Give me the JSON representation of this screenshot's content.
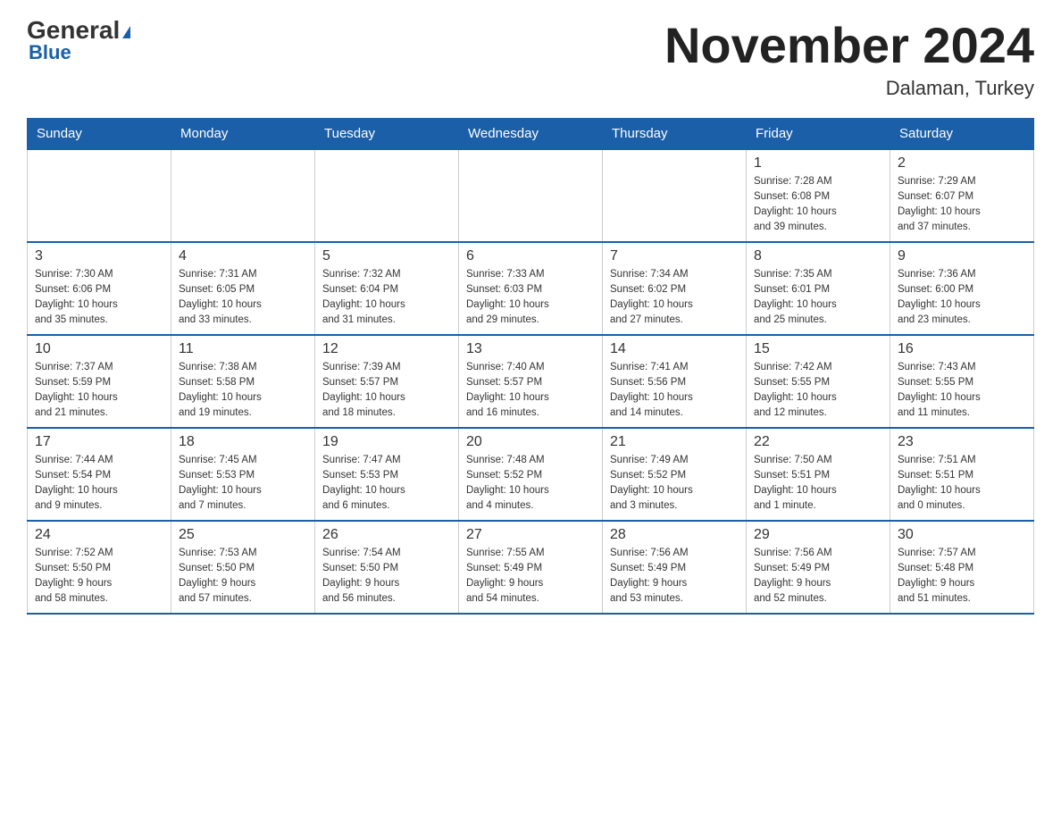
{
  "header": {
    "logo_general": "General",
    "logo_blue": "Blue",
    "month_title": "November 2024",
    "location": "Dalaman, Turkey"
  },
  "calendar": {
    "days_of_week": [
      "Sunday",
      "Monday",
      "Tuesday",
      "Wednesday",
      "Thursday",
      "Friday",
      "Saturday"
    ],
    "weeks": [
      [
        {
          "day": "",
          "info": ""
        },
        {
          "day": "",
          "info": ""
        },
        {
          "day": "",
          "info": ""
        },
        {
          "day": "",
          "info": ""
        },
        {
          "day": "",
          "info": ""
        },
        {
          "day": "1",
          "info": "Sunrise: 7:28 AM\nSunset: 6:08 PM\nDaylight: 10 hours\nand 39 minutes."
        },
        {
          "day": "2",
          "info": "Sunrise: 7:29 AM\nSunset: 6:07 PM\nDaylight: 10 hours\nand 37 minutes."
        }
      ],
      [
        {
          "day": "3",
          "info": "Sunrise: 7:30 AM\nSunset: 6:06 PM\nDaylight: 10 hours\nand 35 minutes."
        },
        {
          "day": "4",
          "info": "Sunrise: 7:31 AM\nSunset: 6:05 PM\nDaylight: 10 hours\nand 33 minutes."
        },
        {
          "day": "5",
          "info": "Sunrise: 7:32 AM\nSunset: 6:04 PM\nDaylight: 10 hours\nand 31 minutes."
        },
        {
          "day": "6",
          "info": "Sunrise: 7:33 AM\nSunset: 6:03 PM\nDaylight: 10 hours\nand 29 minutes."
        },
        {
          "day": "7",
          "info": "Sunrise: 7:34 AM\nSunset: 6:02 PM\nDaylight: 10 hours\nand 27 minutes."
        },
        {
          "day": "8",
          "info": "Sunrise: 7:35 AM\nSunset: 6:01 PM\nDaylight: 10 hours\nand 25 minutes."
        },
        {
          "day": "9",
          "info": "Sunrise: 7:36 AM\nSunset: 6:00 PM\nDaylight: 10 hours\nand 23 minutes."
        }
      ],
      [
        {
          "day": "10",
          "info": "Sunrise: 7:37 AM\nSunset: 5:59 PM\nDaylight: 10 hours\nand 21 minutes."
        },
        {
          "day": "11",
          "info": "Sunrise: 7:38 AM\nSunset: 5:58 PM\nDaylight: 10 hours\nand 19 minutes."
        },
        {
          "day": "12",
          "info": "Sunrise: 7:39 AM\nSunset: 5:57 PM\nDaylight: 10 hours\nand 18 minutes."
        },
        {
          "day": "13",
          "info": "Sunrise: 7:40 AM\nSunset: 5:57 PM\nDaylight: 10 hours\nand 16 minutes."
        },
        {
          "day": "14",
          "info": "Sunrise: 7:41 AM\nSunset: 5:56 PM\nDaylight: 10 hours\nand 14 minutes."
        },
        {
          "day": "15",
          "info": "Sunrise: 7:42 AM\nSunset: 5:55 PM\nDaylight: 10 hours\nand 12 minutes."
        },
        {
          "day": "16",
          "info": "Sunrise: 7:43 AM\nSunset: 5:55 PM\nDaylight: 10 hours\nand 11 minutes."
        }
      ],
      [
        {
          "day": "17",
          "info": "Sunrise: 7:44 AM\nSunset: 5:54 PM\nDaylight: 10 hours\nand 9 minutes."
        },
        {
          "day": "18",
          "info": "Sunrise: 7:45 AM\nSunset: 5:53 PM\nDaylight: 10 hours\nand 7 minutes."
        },
        {
          "day": "19",
          "info": "Sunrise: 7:47 AM\nSunset: 5:53 PM\nDaylight: 10 hours\nand 6 minutes."
        },
        {
          "day": "20",
          "info": "Sunrise: 7:48 AM\nSunset: 5:52 PM\nDaylight: 10 hours\nand 4 minutes."
        },
        {
          "day": "21",
          "info": "Sunrise: 7:49 AM\nSunset: 5:52 PM\nDaylight: 10 hours\nand 3 minutes."
        },
        {
          "day": "22",
          "info": "Sunrise: 7:50 AM\nSunset: 5:51 PM\nDaylight: 10 hours\nand 1 minute."
        },
        {
          "day": "23",
          "info": "Sunrise: 7:51 AM\nSunset: 5:51 PM\nDaylight: 10 hours\nand 0 minutes."
        }
      ],
      [
        {
          "day": "24",
          "info": "Sunrise: 7:52 AM\nSunset: 5:50 PM\nDaylight: 9 hours\nand 58 minutes."
        },
        {
          "day": "25",
          "info": "Sunrise: 7:53 AM\nSunset: 5:50 PM\nDaylight: 9 hours\nand 57 minutes."
        },
        {
          "day": "26",
          "info": "Sunrise: 7:54 AM\nSunset: 5:50 PM\nDaylight: 9 hours\nand 56 minutes."
        },
        {
          "day": "27",
          "info": "Sunrise: 7:55 AM\nSunset: 5:49 PM\nDaylight: 9 hours\nand 54 minutes."
        },
        {
          "day": "28",
          "info": "Sunrise: 7:56 AM\nSunset: 5:49 PM\nDaylight: 9 hours\nand 53 minutes."
        },
        {
          "day": "29",
          "info": "Sunrise: 7:56 AM\nSunset: 5:49 PM\nDaylight: 9 hours\nand 52 minutes."
        },
        {
          "day": "30",
          "info": "Sunrise: 7:57 AM\nSunset: 5:48 PM\nDaylight: 9 hours\nand 51 minutes."
        }
      ]
    ]
  }
}
